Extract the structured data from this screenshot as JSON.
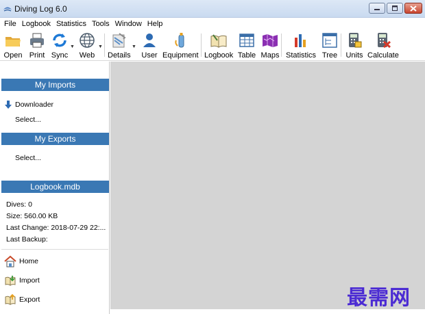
{
  "window": {
    "title": "Diving Log 6.0"
  },
  "menu": [
    "File",
    "Logbook",
    "Statistics",
    "Tools",
    "Window",
    "Help"
  ],
  "toolbar": {
    "open": "Open",
    "print": "Print",
    "sync": "Sync",
    "web": "Web",
    "details": "Details",
    "user": "User",
    "equipment": "Equipment",
    "logbook": "Logbook",
    "table": "Table",
    "maps": "Maps",
    "statistics": "Statistics",
    "tree": "Tree",
    "units": "Units",
    "calculate": "Calculate"
  },
  "sidebar": {
    "imports_header": "My Imports",
    "downloader": "Downloader",
    "imports_select": "Select...",
    "exports_header": "My Exports",
    "exports_select": "Select...",
    "db_header": "Logbook.mdb",
    "dives": "Dives: 0",
    "size": "Size: 560.00 KB",
    "last_change": "Last Change: 2018-07-29 22:...",
    "last_backup": "Last Backup:",
    "home": "Home",
    "import": "Import",
    "export": "Export"
  },
  "watermark": "最需网",
  "colors": {
    "section_header": "#3a78b4",
    "workspace": "#d4d4d4",
    "watermark": "#4b2bd3"
  }
}
